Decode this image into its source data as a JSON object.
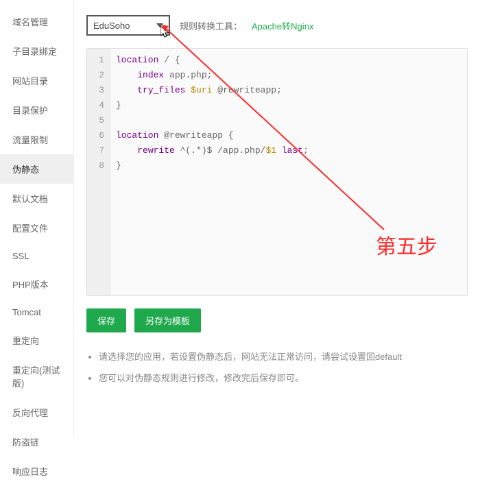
{
  "sidebar": {
    "items": [
      {
        "label": "域名管理",
        "active": false
      },
      {
        "label": "子目录绑定",
        "active": false
      },
      {
        "label": "网站目录",
        "active": false
      },
      {
        "label": "目录保护",
        "active": false
      },
      {
        "label": "流量限制",
        "active": false
      },
      {
        "label": "伪静态",
        "active": true
      },
      {
        "label": "默认文档",
        "active": false
      },
      {
        "label": "配置文件",
        "active": false
      },
      {
        "label": "SSL",
        "active": false
      },
      {
        "label": "PHP版本",
        "active": false
      },
      {
        "label": "Tomcat",
        "active": false
      },
      {
        "label": "重定向",
        "active": false
      },
      {
        "label": "重定向(测试版)",
        "active": false
      },
      {
        "label": "反向代理",
        "active": false
      },
      {
        "label": "防盗链",
        "active": false
      },
      {
        "label": "响应日志",
        "active": false
      }
    ]
  },
  "topbar": {
    "select_value": "EduSoho",
    "tool_label": "规则转换工具：",
    "tool_link": "Apache转Nginx"
  },
  "code": {
    "line_numbers": [
      "1",
      "2",
      "3",
      "4",
      "5",
      "6",
      "7",
      "8"
    ],
    "lines": [
      "location / {",
      "    index app.php;",
      "    try_files $uri @rewriteapp;",
      "}",
      "",
      "location @rewriteapp {",
      "    rewrite ^(.*)$ /app.php/$1 last;",
      "}"
    ]
  },
  "buttons": {
    "save": "保存",
    "save_as": "另存为模板"
  },
  "notes": {
    "item1": "请选择您的应用，若设置伪静态后，网站无法正常访问，请尝试设置回default",
    "item2": "您可以对伪静态规则进行修改，修改完后保存即可。"
  },
  "annotation": {
    "text": "第五步"
  }
}
